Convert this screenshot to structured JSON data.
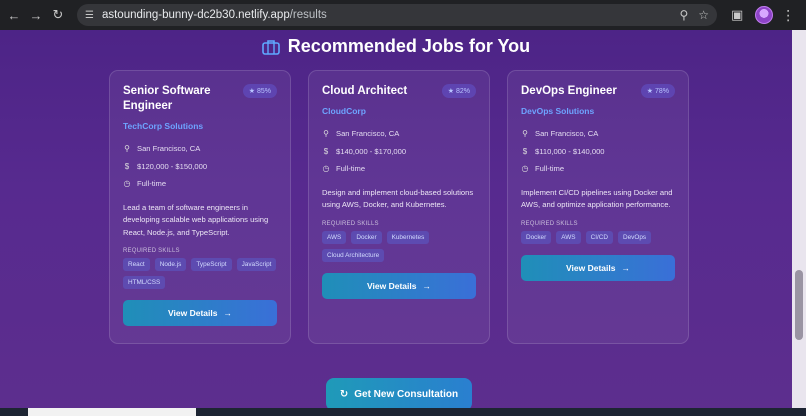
{
  "browser": {
    "url_host": "astounding-bunny-dc2b30.netlify.app",
    "url_path": "/results"
  },
  "icons": {
    "back": "arrow-left-icon",
    "forward": "arrow-right-icon",
    "reload": "reload-icon",
    "site_info": "tune-icon",
    "zoom": "zoom-icon",
    "bookmark": "star-icon",
    "extensions": "puzzle-icon",
    "menu": "kebab-menu-icon",
    "heading": "briefcase-icon",
    "location": "map-pin-icon",
    "salary": "dollar-icon",
    "type": "clock-icon"
  },
  "page": {
    "title": "Recommended Jobs for You",
    "consult_label": "Get New Consultation"
  },
  "colors": {
    "accent": "#6ea4ff",
    "button_start": "#1f8fb8",
    "button_end": "#3a6fd8"
  },
  "jobs": [
    {
      "title": "Senior Software Engineer",
      "match": "★ 85%",
      "company": "TechCorp Solutions",
      "location": "San Francisco, CA",
      "salary": "$120,000 - $150,000",
      "type": "Full-time",
      "description": "Lead a team of software engineers in developing scalable web applications using React, Node.js, and TypeScript.",
      "skills_label": "REQUIRED SKILLS",
      "skills": [
        "React",
        "Node.js",
        "TypeScript",
        "JavaScript",
        "HTML/CSS"
      ],
      "button": "View Details"
    },
    {
      "title": "Cloud Architect",
      "match": "★ 82%",
      "company": "CloudCorp",
      "location": "San Francisco, CA",
      "salary": "$140,000 - $170,000",
      "type": "Full-time",
      "description": "Design and implement cloud-based solutions using AWS, Docker, and Kubernetes.",
      "skills_label": "REQUIRED SKILLS",
      "skills": [
        "AWS",
        "Docker",
        "Kubernetes",
        "Cloud Architecture"
      ],
      "button": "View Details"
    },
    {
      "title": "DevOps Engineer",
      "match": "★ 78%",
      "company": "DevOps Solutions",
      "location": "San Francisco, CA",
      "salary": "$110,000 - $140,000",
      "type": "Full-time",
      "description": "Implement CI/CD pipelines using Docker and AWS, and optimize application performance.",
      "skills_label": "REQUIRED SKILLS",
      "skills": [
        "Docker",
        "AWS",
        "CI/CD",
        "DevOps"
      ],
      "button": "View Details"
    }
  ]
}
